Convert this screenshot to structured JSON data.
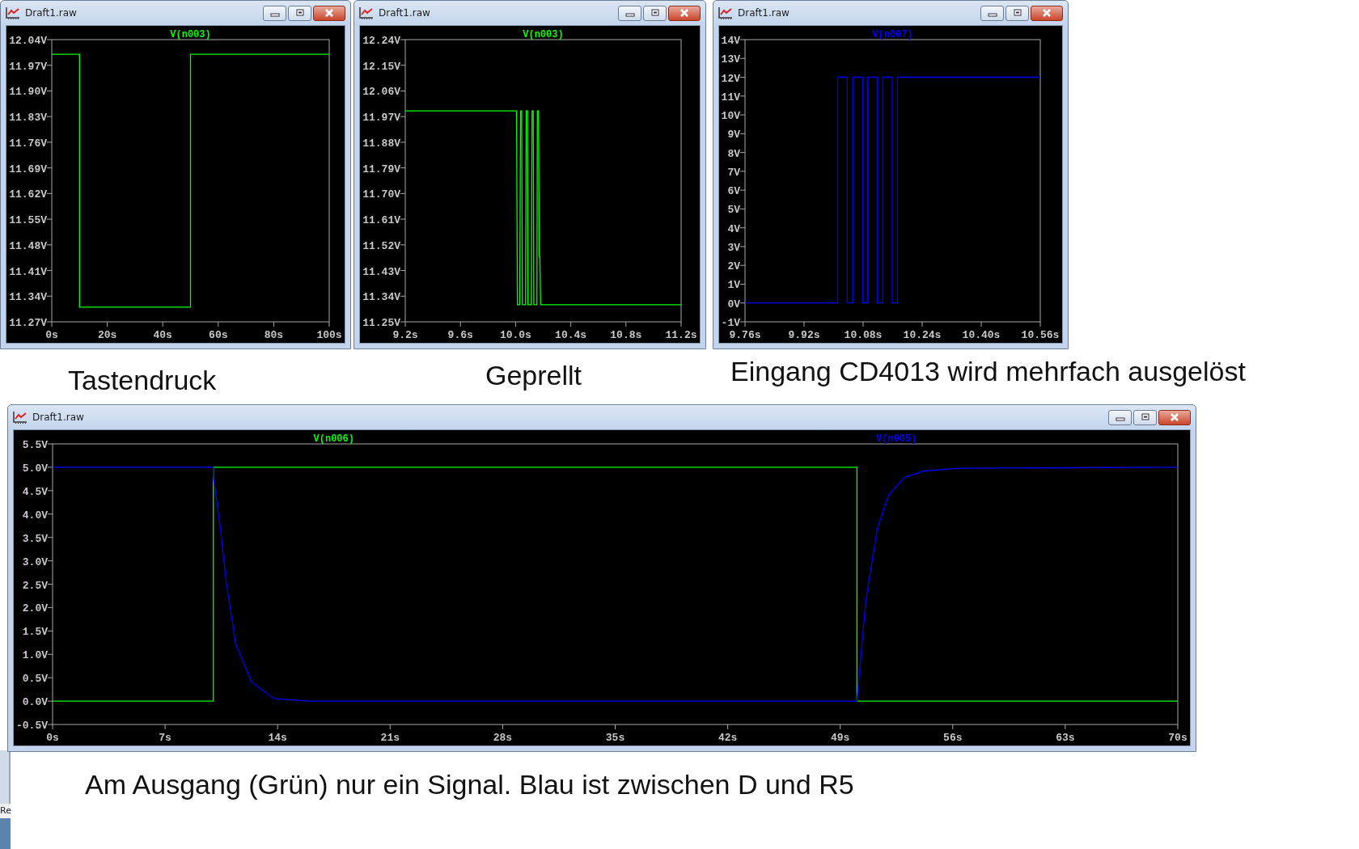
{
  "windows": [
    {
      "title": "Draft1.raw",
      "caption": "Tastendruck",
      "chart_data": {
        "type": "line",
        "xlim": [
          0,
          100
        ],
        "ylim": [
          11.27,
          12.04
        ],
        "xticks": [
          {
            "value": 0,
            "label": "0s"
          },
          {
            "value": 20,
            "label": "20s"
          },
          {
            "value": 40,
            "label": "40s"
          },
          {
            "value": 60,
            "label": "60s"
          },
          {
            "value": 80,
            "label": "80s"
          },
          {
            "value": 100,
            "label": "100s"
          }
        ],
        "yticks": [
          {
            "value": 12.04,
            "label": "12.04V"
          },
          {
            "value": 11.97,
            "label": "11.97V"
          },
          {
            "value": 11.9,
            "label": "11.90V"
          },
          {
            "value": 11.83,
            "label": "11.83V"
          },
          {
            "value": 11.76,
            "label": "11.76V"
          },
          {
            "value": 11.69,
            "label": "11.69V"
          },
          {
            "value": 11.62,
            "label": "11.62V"
          },
          {
            "value": 11.55,
            "label": "11.55V"
          },
          {
            "value": 11.48,
            "label": "11.48V"
          },
          {
            "value": 11.41,
            "label": "11.41V"
          },
          {
            "value": 11.34,
            "label": "11.34V"
          },
          {
            "value": 11.27,
            "label": "11.27V"
          }
        ],
        "x": [
          0,
          10,
          10,
          50,
          50,
          100
        ],
        "series": [
          {
            "name": "V(n003)",
            "color": "#00ff00",
            "values": [
              12.0,
              12.0,
              11.31,
              11.31,
              12.0,
              12.0
            ]
          }
        ]
      }
    },
    {
      "title": "Draft1.raw",
      "caption": "Geprellt",
      "chart_data": {
        "type": "line",
        "xlim": [
          9.2,
          11.2
        ],
        "ylim": [
          11.25,
          12.24
        ],
        "xticks": [
          {
            "value": 9.2,
            "label": "9.2s"
          },
          {
            "value": 9.6,
            "label": "9.6s"
          },
          {
            "value": 10.0,
            "label": "10.0s"
          },
          {
            "value": 10.4,
            "label": "10.4s"
          },
          {
            "value": 10.8,
            "label": "10.8s"
          },
          {
            "value": 11.2,
            "label": "11.2s"
          }
        ],
        "yticks": [
          {
            "value": 12.24,
            "label": "12.24V"
          },
          {
            "value": 12.15,
            "label": "12.15V"
          },
          {
            "value": 12.06,
            "label": "12.06V"
          },
          {
            "value": 11.97,
            "label": "11.97V"
          },
          {
            "value": 11.88,
            "label": "11.88V"
          },
          {
            "value": 11.79,
            "label": "11.79V"
          },
          {
            "value": 11.7,
            "label": "11.70V"
          },
          {
            "value": 11.61,
            "label": "11.61V"
          },
          {
            "value": 11.52,
            "label": "11.52V"
          },
          {
            "value": 11.43,
            "label": "11.43V"
          },
          {
            "value": 11.34,
            "label": "11.34V"
          },
          {
            "value": 11.25,
            "label": "11.25V"
          }
        ],
        "x": [
          9.2,
          10.007,
          10.013,
          10.03,
          10.036,
          10.044,
          10.049,
          10.056,
          10.072,
          10.077,
          10.086,
          10.09,
          10.098,
          10.114,
          10.119,
          10.128,
          10.132,
          10.14,
          10.154,
          10.158,
          10.166,
          10.172,
          10.176,
          10.181,
          11.2
        ],
        "series": [
          {
            "name": "V(n003)",
            "color": "#00ff00",
            "values": [
              11.99,
              11.99,
              11.31,
              11.31,
              11.99,
              11.99,
              11.31,
              11.31,
              11.31,
              11.99,
              11.99,
              11.31,
              11.31,
              11.31,
              11.99,
              11.99,
              11.31,
              11.31,
              11.31,
              11.99,
              11.99,
              11.48,
              11.48,
              11.31,
              11.31
            ]
          }
        ]
      }
    },
    {
      "title": "Draft1.raw",
      "caption": "Eingang CD4013 wird mehrfach ausgelöst",
      "chart_data": {
        "type": "line",
        "xlim": [
          9.76,
          10.56
        ],
        "ylim": [
          -1,
          14
        ],
        "xticks": [
          {
            "value": 9.76,
            "label": "9.76s"
          },
          {
            "value": 9.92,
            "label": "9.92s"
          },
          {
            "value": 10.08,
            "label": "10.08s"
          },
          {
            "value": 10.24,
            "label": "10.24s"
          },
          {
            "value": 10.4,
            "label": "10.40s"
          },
          {
            "value": 10.56,
            "label": "10.56s"
          }
        ],
        "yticks": [
          {
            "value": 14,
            "label": "14V"
          },
          {
            "value": 13,
            "label": "13V"
          },
          {
            "value": 12,
            "label": "12V"
          },
          {
            "value": 11,
            "label": "11V"
          },
          {
            "value": 10,
            "label": "10V"
          },
          {
            "value": 9,
            "label": "9V"
          },
          {
            "value": 8,
            "label": "8V"
          },
          {
            "value": 7,
            "label": "7V"
          },
          {
            "value": 6,
            "label": "6V"
          },
          {
            "value": 5,
            "label": "5V"
          },
          {
            "value": 4,
            "label": "4V"
          },
          {
            "value": 3,
            "label": "3V"
          },
          {
            "value": 2,
            "label": "2V"
          },
          {
            "value": 1,
            "label": "1V"
          },
          {
            "value": 0,
            "label": "0V"
          },
          {
            "value": -1,
            "label": "-1V"
          }
        ],
        "x": [
          9.76,
          10.011,
          10.011,
          10.037,
          10.037,
          10.052,
          10.052,
          10.079,
          10.079,
          10.092,
          10.092,
          10.118,
          10.118,
          10.133,
          10.133,
          10.159,
          10.159,
          10.173,
          10.173,
          10.56
        ],
        "series": [
          {
            "name": "V(n007)",
            "color": "#0000ff",
            "values": [
              0,
              0,
              12,
              12,
              0,
              0,
              12,
              12,
              0,
              0,
              12,
              12,
              0,
              0,
              12,
              12,
              0,
              0,
              12,
              12
            ]
          }
        ]
      }
    },
    {
      "title": "Draft1.raw",
      "caption": "Am Ausgang (Grün) nur ein Signal. Blau ist zwischen D und R5",
      "chart_data": {
        "type": "line",
        "xlim": [
          0,
          70
        ],
        "ylim": [
          -0.5,
          5.5
        ],
        "xticks": [
          {
            "value": 0,
            "label": "0s"
          },
          {
            "value": 7,
            "label": "7s"
          },
          {
            "value": 14,
            "label": "14s"
          },
          {
            "value": 21,
            "label": "21s"
          },
          {
            "value": 28,
            "label": "28s"
          },
          {
            "value": 35,
            "label": "35s"
          },
          {
            "value": 42,
            "label": "42s"
          },
          {
            "value": 49,
            "label": "49s"
          },
          {
            "value": 56,
            "label": "56s"
          },
          {
            "value": 63,
            "label": "63s"
          },
          {
            "value": 70,
            "label": "70s"
          }
        ],
        "yticks": [
          {
            "value": 5.5,
            "label": "5.5V"
          },
          {
            "value": 5.0,
            "label": "5.0V"
          },
          {
            "value": 4.5,
            "label": "4.5V"
          },
          {
            "value": 4.0,
            "label": "4.0V"
          },
          {
            "value": 3.5,
            "label": "3.5V"
          },
          {
            "value": 3.0,
            "label": "3.0V"
          },
          {
            "value": 2.5,
            "label": "2.5V"
          },
          {
            "value": 2.0,
            "label": "2.0V"
          },
          {
            "value": 1.5,
            "label": "1.5V"
          },
          {
            "value": 1.0,
            "label": "1.0V"
          },
          {
            "value": 0.5,
            "label": "0.5V"
          },
          {
            "value": 0.0,
            "label": "0.0V"
          },
          {
            "value": -0.5,
            "label": "-0.5V"
          }
        ],
        "x": [
          0,
          10,
          10,
          10.4,
          10.8,
          11.4,
          12.4,
          13.8,
          16,
          50.04,
          50.04,
          50.6,
          51.3,
          52,
          53,
          54.2,
          56.4,
          70
        ],
        "series": [
          {
            "name": "V(n006)",
            "color": "#00ff00",
            "values": [
              0,
              0,
              5,
              5,
              5,
              5,
              5,
              5,
              5,
              5,
              0,
              0,
              0,
              0,
              0,
              0,
              0,
              0
            ]
          },
          {
            "name": "V(n005)",
            "color": "#0000ff",
            "values": [
              5,
              5,
              4.8,
              3.8,
              2.56,
              1.21,
              0.4,
              0.05,
              0,
              0,
              0,
              2.17,
              3.68,
              4.4,
              4.78,
              4.92,
              4.98,
              5
            ]
          }
        ]
      }
    }
  ],
  "background_window": {
    "title_fragment": "Re"
  }
}
